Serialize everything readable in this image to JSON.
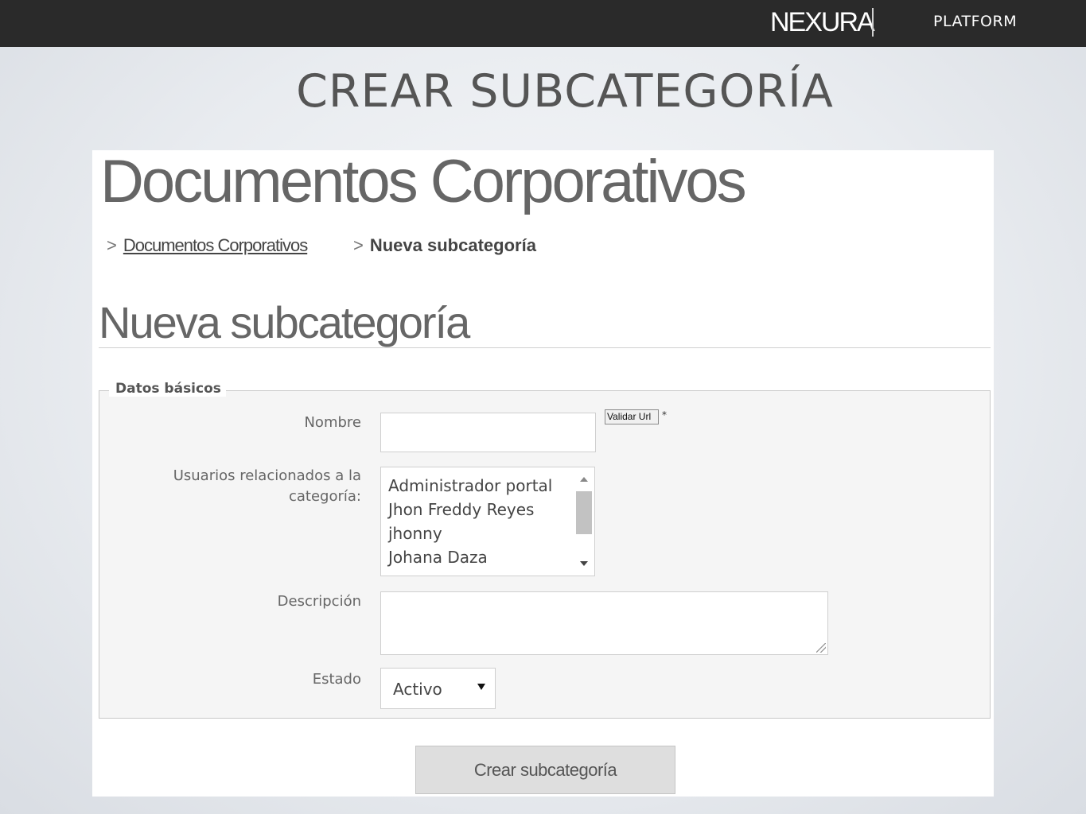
{
  "header": {
    "logo_text": "NEXURA",
    "platform_label": "PLATFORM"
  },
  "slide": {
    "title": "CREAR SUBCATEGORÍA"
  },
  "app": {
    "page_title": "Documentos Corporativos",
    "breadcrumb": [
      {
        "label": "Documentos Corporativos",
        "link": true
      },
      {
        "label": "Nueva subcategoría",
        "link": false
      }
    ],
    "section_title": "Nueva subcategoría",
    "form": {
      "legend": "Datos básicos",
      "nombre_label": "Nombre",
      "nombre_value": "",
      "validar_button": "Validar Url",
      "required_mark": "*",
      "usuarios_label_line1": "Usuarios relacionados a la",
      "usuarios_label_line2": "categoría:",
      "usuarios_options": [
        "Administrador portal",
        "Jhon Freddy Reyes",
        "jhonny",
        "Johana Daza"
      ],
      "descripcion_label": "Descripción",
      "descripcion_value": "",
      "estado_label": "Estado",
      "estado_value": "Activo",
      "submit_label": "Crear subcategoría"
    }
  }
}
